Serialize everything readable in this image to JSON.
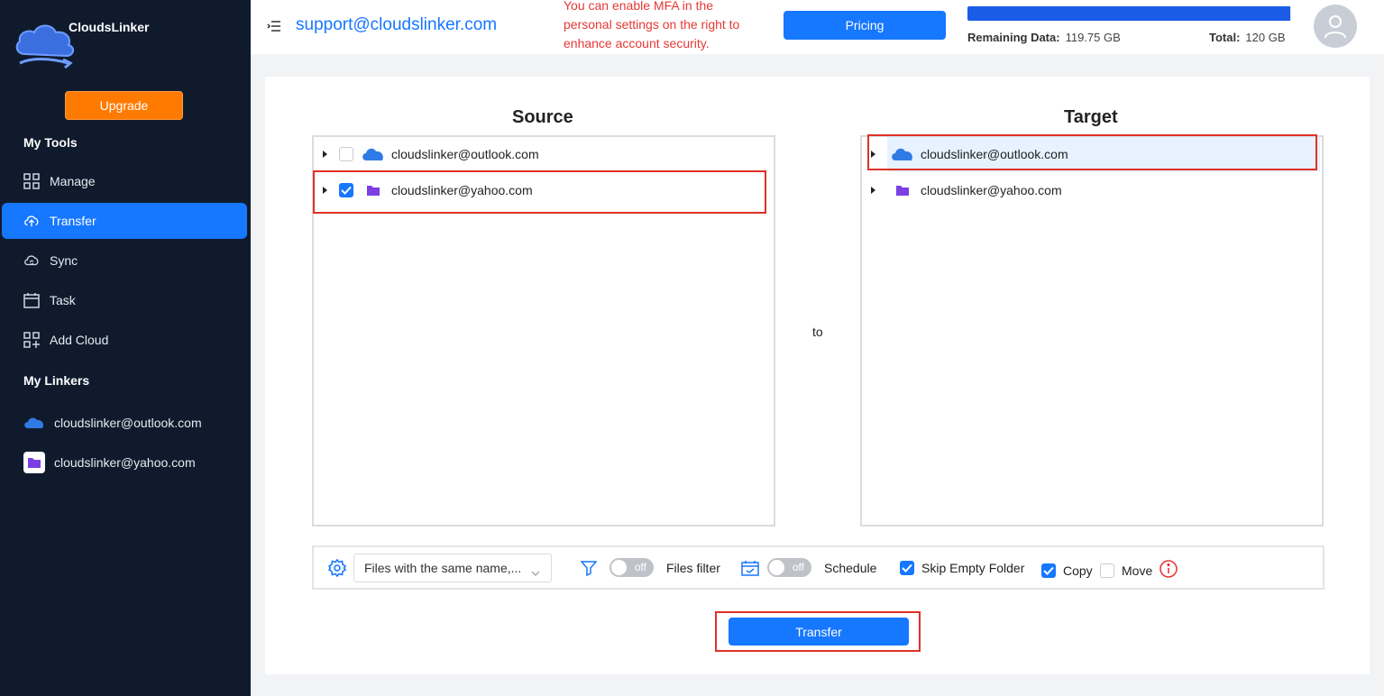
{
  "app": {
    "name": "CloudsLinker"
  },
  "sidebar": {
    "upgrade_label": "Upgrade",
    "my_tools_title": "My Tools",
    "nav": [
      {
        "label": "Manage",
        "icon": "grid-icon"
      },
      {
        "label": "Transfer",
        "icon": "cloud-upload-icon",
        "active": true
      },
      {
        "label": "Sync",
        "icon": "cloud-sync-icon"
      },
      {
        "label": "Task",
        "icon": "calendar-icon"
      },
      {
        "label": "Add Cloud",
        "icon": "add-grid-icon"
      }
    ],
    "my_linkers_title": "My Linkers",
    "linkers": [
      {
        "label": "cloudslinker@outlook.com",
        "icon": "onedrive-icon"
      },
      {
        "label": "cloudslinker@yahoo.com",
        "icon": "yahoo-folder-icon"
      }
    ]
  },
  "header": {
    "support_email": "support@cloudslinker.com",
    "mfa_note": "You can enable MFA in the personal settings on the right to enhance account security.",
    "pricing_label": "Pricing",
    "remaining_label": "Remaining Data:",
    "remaining_value": "119.75 GB",
    "total_label": "Total:",
    "total_value": "120 GB",
    "usage_fraction": 0.998
  },
  "source": {
    "title": "Source",
    "items": [
      {
        "label": "cloudslinker@outlook.com",
        "checked": false,
        "icon": "onedrive-icon"
      },
      {
        "label": "cloudslinker@yahoo.com",
        "checked": true,
        "icon": "yahoo-folder-icon"
      }
    ]
  },
  "to_label": "to",
  "target": {
    "title": "Target",
    "items": [
      {
        "label": "cloudslinker@outlook.com",
        "selected": true,
        "icon": "onedrive-icon"
      },
      {
        "label": "cloudslinker@yahoo.com",
        "selected": false,
        "icon": "yahoo-folder-icon"
      }
    ]
  },
  "options": {
    "conflict_select": "Files with the same name,...",
    "files_filter_toggle": "off",
    "files_filter_label": "Files filter",
    "schedule_toggle": "off",
    "schedule_label": "Schedule",
    "skip_empty_folder_label": "Skip Empty Folder",
    "skip_empty_folder_checked": true,
    "copy_label": "Copy",
    "copy_checked": true,
    "move_label": "Move",
    "move_checked": false
  },
  "transfer_label": "Transfer",
  "colors": {
    "accent": "#1677ff",
    "sidebar_bg": "#0f1b2d",
    "upgrade": "#ff7a00",
    "highlight_frame": "#e03127",
    "warning_text": "#e53935"
  }
}
